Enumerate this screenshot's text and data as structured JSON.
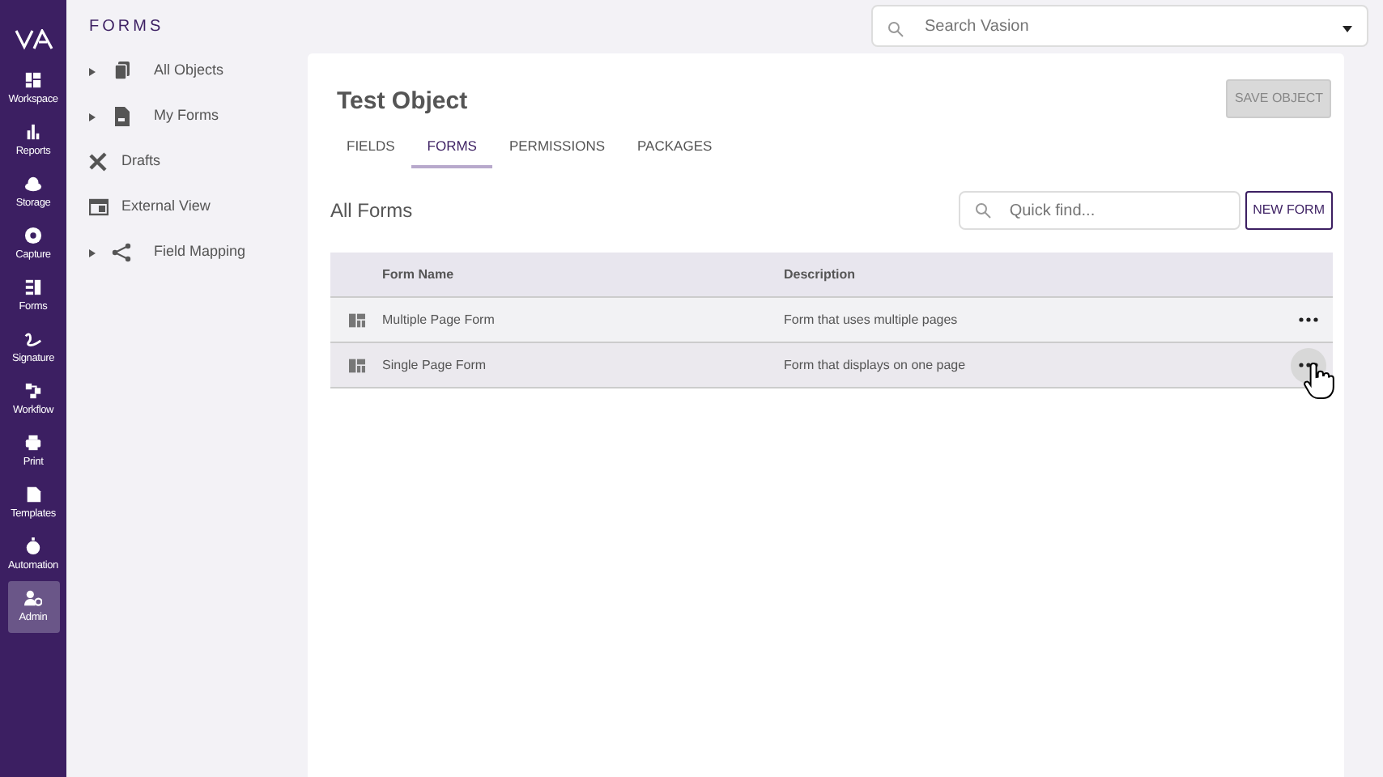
{
  "rail": {
    "items": [
      {
        "label": "Workspace",
        "selected": false
      },
      {
        "label": "Reports",
        "selected": false
      },
      {
        "label": "Storage",
        "selected": false
      },
      {
        "label": "Capture",
        "selected": false
      },
      {
        "label": "Forms",
        "selected": false
      },
      {
        "label": "Signature",
        "selected": false
      },
      {
        "label": "Workflow",
        "selected": false
      },
      {
        "label": "Print",
        "selected": false
      },
      {
        "label": "Templates",
        "selected": false
      },
      {
        "label": "Automation",
        "selected": false
      },
      {
        "label": "Admin",
        "selected": true
      }
    ]
  },
  "sidebar": {
    "title": "FORMS",
    "items": [
      {
        "label": "All Objects",
        "expandable": true
      },
      {
        "label": "My Forms",
        "expandable": true
      },
      {
        "label": "Drafts",
        "expandable": false
      },
      {
        "label": "External View",
        "expandable": false
      },
      {
        "label": "Field Mapping",
        "expandable": true
      }
    ]
  },
  "search": {
    "placeholder": "Search Vasion"
  },
  "main": {
    "title": "Test Object",
    "save_button": "SAVE OBJECT",
    "tabs": [
      {
        "label": "FIELDS",
        "selected": false
      },
      {
        "label": "FORMS",
        "selected": true
      },
      {
        "label": "PERMISSIONS",
        "selected": false
      },
      {
        "label": "PACKAGES",
        "selected": false
      }
    ],
    "section_title": "All Forms",
    "quick_find": {
      "placeholder": "Quick find..."
    },
    "new_button": "NEW FORM",
    "table": {
      "columns": [
        "Form Name",
        "Description"
      ],
      "rows": [
        {
          "name": "Multiple Page Form",
          "description": "Form that uses multiple pages",
          "hovered": false
        },
        {
          "name": "Single Page Form",
          "description": "Form that displays on one page",
          "hovered": true
        }
      ]
    }
  }
}
